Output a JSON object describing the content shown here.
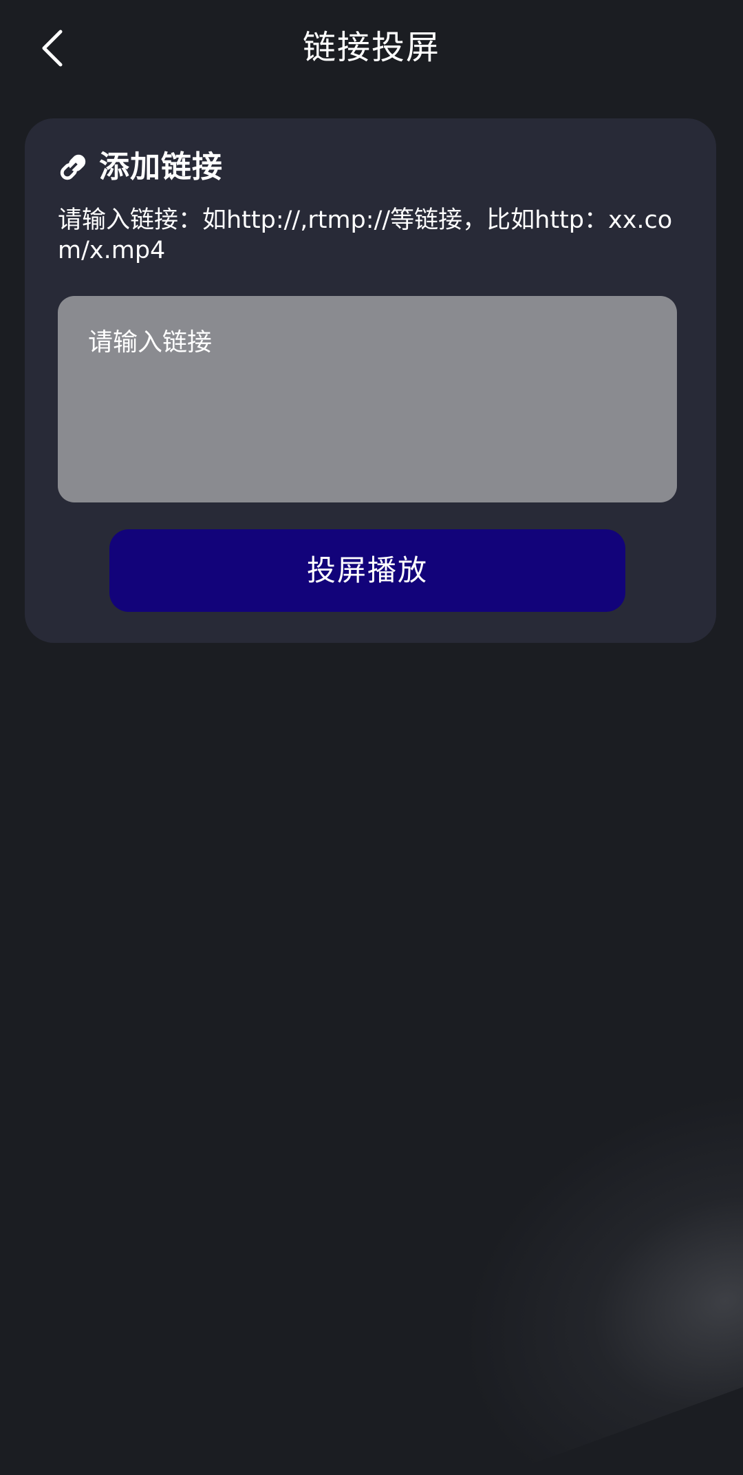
{
  "header": {
    "title": "链接投屏",
    "back_icon": "chevron-left-icon"
  },
  "card": {
    "icon": "link-icon",
    "title": "添加链接",
    "hint": "请输入链接：如http://,rtmp://等链接，比如http：xx.com/x.mp4",
    "input": {
      "value": "",
      "placeholder": "请输入链接"
    },
    "button_label": "投屏播放"
  },
  "colors": {
    "background": "#1b1d22",
    "card": "#282a37",
    "input": "#8a8b90",
    "button": "#12037a",
    "text": "#ffffff"
  }
}
